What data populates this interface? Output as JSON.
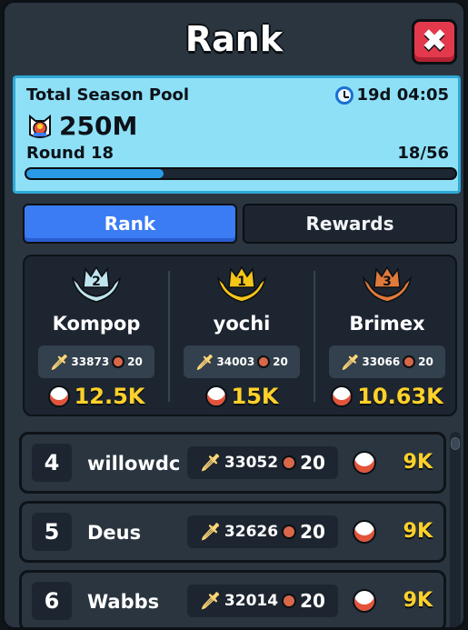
{
  "header": {
    "title": "Rank",
    "close_icon": "close-icon"
  },
  "pool": {
    "title": "Total Season Pool",
    "timer": "19d 04:05",
    "amount": "250M",
    "round_label": "Round 18",
    "round_progress_text": "18/56",
    "round_progress": 0.32
  },
  "tabs": [
    {
      "label": "Rank",
      "active": true
    },
    {
      "label": "Rewards",
      "active": false
    }
  ],
  "podium": [
    {
      "place": "2",
      "name": "Kompop",
      "power": "33873",
      "level": "20",
      "reward": "12.5K",
      "laurel_color": "#bfe4ee"
    },
    {
      "place": "1",
      "name": "yochi",
      "power": "34003",
      "level": "20",
      "reward": "15K",
      "laurel_color": "#f5c518"
    },
    {
      "place": "3",
      "name": "Brimex",
      "power": "33066",
      "level": "20",
      "reward": "10.63K",
      "laurel_color": "#e07a3a"
    }
  ],
  "rows": [
    {
      "rank": "4",
      "name": "willowdc",
      "power": "33052",
      "level": "20",
      "reward": "9K"
    },
    {
      "rank": "5",
      "name": "Deus",
      "power": "32626",
      "level": "20",
      "reward": "9K"
    },
    {
      "rank": "6",
      "name": "Wabbs",
      "power": "32014",
      "level": "20",
      "reward": "9K"
    }
  ],
  "colors": {
    "accent_blue": "#3b7cf5",
    "gold": "#ffd12a",
    "pool_bg": "#8ee0f7"
  }
}
